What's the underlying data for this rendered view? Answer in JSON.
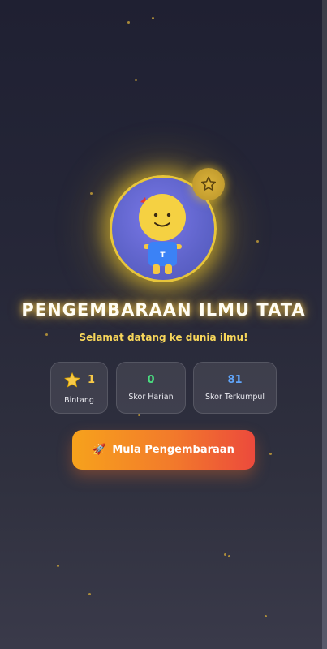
{
  "hero": {
    "title": "PENGEMBARAAN ILMU TATA",
    "subtitle": "Selamat datang ke dunia ilmu!",
    "avatar_shirt_letter": "T"
  },
  "stats": [
    {
      "value": "1",
      "label": "Bintang",
      "color": "#f7c948",
      "icon": "star-icon"
    },
    {
      "value": "0",
      "label": "Skor Harian",
      "color": "#4ade80"
    },
    {
      "value": "81",
      "label": "Skor Terkumpul",
      "color": "#60a5fa"
    }
  ],
  "cta": {
    "icon": "🚀",
    "label": "Mula Pengembaraan"
  },
  "colors": {
    "gold": "#e7c53a",
    "cta_start": "#f7a21c",
    "cta_end": "#ec4a3c"
  }
}
